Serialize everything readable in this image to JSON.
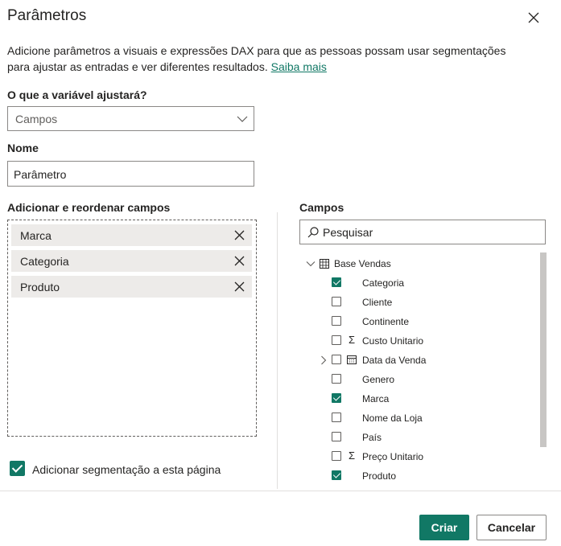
{
  "dialog": {
    "title": "Parâmetros",
    "description": "Adicione parâmetros a visuais e expressões DAX para que as pessoas possam usar segmentações para ajustar as entradas e ver diferentes resultados.",
    "learn_more": "Saiba mais"
  },
  "variable": {
    "label": "O que a variável ajustará?",
    "selected": "Campos"
  },
  "name": {
    "label": "Nome",
    "value": "Parâmetro"
  },
  "fields_well": {
    "label": "Adicionar e reordenar campos",
    "items": [
      "Marca",
      "Categoria",
      "Produto"
    ]
  },
  "fields_pane": {
    "label": "Campos",
    "search_placeholder": "Pesquisar",
    "table_name": "Base Vendas",
    "fields": [
      {
        "name": "Categoria",
        "checked": true,
        "type": "",
        "expandable": false
      },
      {
        "name": "Cliente",
        "checked": false,
        "type": "",
        "expandable": false
      },
      {
        "name": "Continente",
        "checked": false,
        "type": "",
        "expandable": false
      },
      {
        "name": "Custo Unitario",
        "checked": false,
        "type": "sigma-icon",
        "expandable": false
      },
      {
        "name": "Data da Venda",
        "checked": false,
        "type": "calendar-icon",
        "expandable": true
      },
      {
        "name": "Genero",
        "checked": false,
        "type": "",
        "expandable": false
      },
      {
        "name": "Marca",
        "checked": true,
        "type": "",
        "expandable": false
      },
      {
        "name": "Nome da Loja",
        "checked": false,
        "type": "",
        "expandable": false
      },
      {
        "name": "País",
        "checked": false,
        "type": "",
        "expandable": false
      },
      {
        "name": "Preço Unitario",
        "checked": false,
        "type": "sigma-icon",
        "expandable": false
      },
      {
        "name": "Produto",
        "checked": true,
        "type": "",
        "expandable": false
      }
    ]
  },
  "add_slicer": {
    "label": "Adicionar segmentação a esta página",
    "checked": true
  },
  "buttons": {
    "create": "Criar",
    "cancel": "Cancelar"
  },
  "colors": {
    "accent": "#117865",
    "chip_bg": "#edebe9",
    "border": "#8a8886"
  }
}
